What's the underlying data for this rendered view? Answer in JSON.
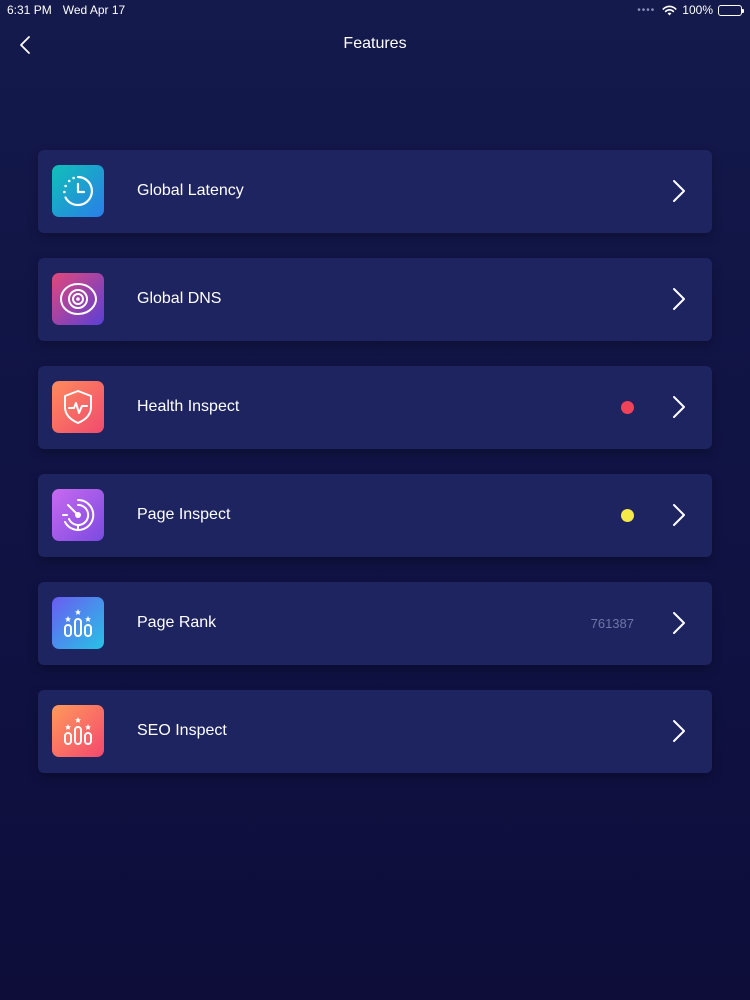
{
  "status_bar": {
    "time": "6:31 PM",
    "date": "Wed Apr 17",
    "battery": "100%",
    "battery_level": 1.0
  },
  "nav": {
    "title": "Features",
    "back_icon": "chevron-left-icon"
  },
  "features": [
    {
      "label": "Global Latency",
      "icon": "clock-icon",
      "gradient": [
        "#10c0b8",
        "#2a7ee8"
      ]
    },
    {
      "label": "Global DNS",
      "icon": "target-icon",
      "gradient": [
        "#e2487a",
        "#5a3fd6"
      ]
    },
    {
      "label": "Health Inspect",
      "icon": "shield-pulse-icon",
      "gradient": [
        "#ff8a5c",
        "#f04b6e"
      ],
      "status_color": "#f0435a"
    },
    {
      "label": "Page Inspect",
      "icon": "radar-icon",
      "gradient": [
        "#c86af0",
        "#7b4ae0"
      ],
      "status_color": "#f5e94a"
    },
    {
      "label": "Page Rank",
      "icon": "bar-stars-icon",
      "gradient": [
        "#6a5cf2",
        "#26c3e6"
      ],
      "count": "761387"
    },
    {
      "label": "SEO Inspect",
      "icon": "bar-stars-icon",
      "gradient": [
        "#ff9a5a",
        "#f4486e"
      ]
    }
  ]
}
